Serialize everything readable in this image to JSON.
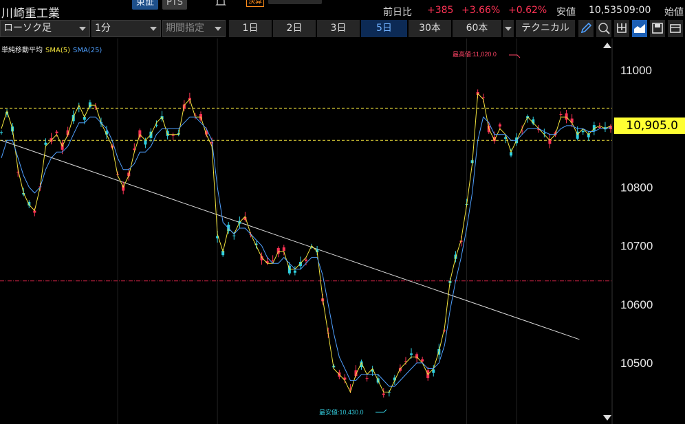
{
  "header": {
    "stock_name": "川崎重工業",
    "exchange_tabs": [
      "東証",
      "PTS"
    ],
    "kessan_badge": "決算",
    "quote": {
      "prev_label": "前日比",
      "change": "+385",
      "change_pct": "+3.66%",
      "change_pct2": "+0.62%",
      "low_label": "安値",
      "low_value": "10,535",
      "time": "09:00",
      "open_label": "始値"
    }
  },
  "toolbar": {
    "chart_type": "ローソク足",
    "interval": "1分",
    "period_placeholder": "期間指定",
    "periods": [
      "1日",
      "2日",
      "3日",
      "5日",
      "30本",
      "60本"
    ],
    "active_period": "5日",
    "technical_label": "テクニカル",
    "tools": [
      "pencil-icon",
      "zoom-icon",
      "out-icon",
      "area-chart-icon",
      "save-icon",
      "settings-icon"
    ]
  },
  "legend": {
    "indicator": "単純移動平均",
    "sma5": "SMA(5)",
    "sma25": "SMA(25)"
  },
  "colors": {
    "up": "#ff3355",
    "sma5": "#f2e43d",
    "sma25": "#4fa0ff",
    "price_box": "#ffff33",
    "active_tab": "#6fb0ff"
  },
  "chart_data": {
    "type": "line",
    "title": "",
    "y_ticks": [
      "11000",
      "10900",
      "10800",
      "10700",
      "10600",
      "10500"
    ],
    "ylim": [
      10415,
      11065
    ],
    "current_price": "10,905.0",
    "high_label": "最高値:11,020.0",
    "low_label": "最安値:10,430.0",
    "hlines": [
      {
        "value": 10935,
        "style": "dashed",
        "color": "#f2e43d"
      },
      {
        "value": 10880,
        "style": "dashed",
        "color": "#f2e43d"
      },
      {
        "value": 10640,
        "style": "dashdot",
        "color": "#cc2244"
      }
    ],
    "trendline": [
      {
        "i": 0,
        "value": 10880
      },
      {
        "i": 100,
        "value": 10540
      }
    ],
    "day_separators": [
      21,
      39,
      84,
      93
    ],
    "x_count": 111,
    "series": [
      {
        "name": "SMA(5)",
        "values": [
          10900,
          10930,
          10900,
          10830,
          10790,
          10770,
          10760,
          10800,
          10870,
          10880,
          10890,
          10870,
          10890,
          10920,
          10940,
          10920,
          10940,
          10940,
          10910,
          10890,
          10870,
          10820,
          10800,
          10820,
          10860,
          10890,
          10880,
          10890,
          10910,
          10920,
          10890,
          10890,
          10890,
          10940,
          10950,
          10920,
          10920,
          10890,
          10870,
          10720,
          10690,
          10730,
          10720,
          10740,
          10750,
          10720,
          10700,
          10680,
          10670,
          10670,
          10690,
          10690,
          10660,
          10660,
          10670,
          10680,
          10700,
          10690,
          10610,
          10550,
          10490,
          10480,
          10470,
          10450,
          10480,
          10500,
          10480,
          10490,
          10470,
          10450,
          10450,
          10470,
          10490,
          10500,
          10510,
          10510,
          10500,
          10480,
          10490,
          10520,
          10560,
          10640,
          10680,
          10710,
          10770,
          10840,
          10960,
          10950,
          10900,
          10880,
          10900,
          10890,
          10860,
          10880,
          10900,
          10920,
          10910,
          10900,
          10890,
          10880,
          10890,
          10920,
          10920,
          10910,
          10890,
          10900,
          10890,
          10900,
          10905,
          10900,
          10905
        ]
      },
      {
        "name": "SMA(25)",
        "values": [
          10850,
          10880,
          10880,
          10850,
          10820,
          10800,
          10790,
          10800,
          10830,
          10850,
          10860,
          10860,
          10870,
          10890,
          10910,
          10910,
          10920,
          10920,
          10910,
          10900,
          10880,
          10850,
          10830,
          10830,
          10840,
          10860,
          10860,
          10870,
          10890,
          10900,
          10900,
          10900,
          10900,
          10910,
          10920,
          10920,
          10910,
          10900,
          10880,
          10800,
          10740,
          10730,
          10720,
          10730,
          10730,
          10720,
          10710,
          10700,
          10680,
          10670,
          10670,
          10680,
          10670,
          10660,
          10660,
          10670,
          10680,
          10680,
          10650,
          10600,
          10550,
          10510,
          10490,
          10470,
          10470,
          10480,
          10480,
          10480,
          10480,
          10470,
          10460,
          10460,
          10470,
          10480,
          10490,
          10500,
          10500,
          10490,
          10490,
          10500,
          10530,
          10590,
          10640,
          10680,
          10730,
          10790,
          10880,
          10920,
          10910,
          10890,
          10890,
          10890,
          10880,
          10880,
          10890,
          10900,
          10900,
          10900,
          10895,
          10890,
          10890,
          10900,
          10905,
          10905,
          10900,
          10900,
          10895,
          10895,
          10900,
          10900,
          10902
        ]
      }
    ]
  }
}
